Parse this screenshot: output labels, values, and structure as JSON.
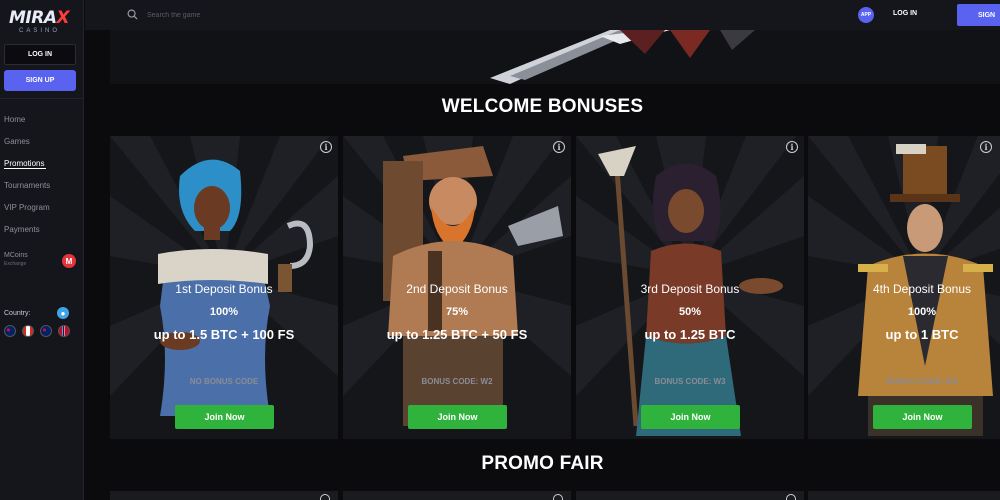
{
  "sidebar": {
    "logo_main": "MIRAX",
    "logo_sub": "CASINO",
    "login_label": "LOG IN",
    "signup_label": "SIGN UP",
    "nav": [
      {
        "label": "Home"
      },
      {
        "label": "Games"
      },
      {
        "label": "Promotions",
        "active": true
      },
      {
        "label": "Tournaments"
      },
      {
        "label": "VIP Program"
      },
      {
        "label": "Payments"
      }
    ],
    "mcoins_label": "MCoins",
    "mcoins_sub": "Exchange",
    "mcoins_badge": "M",
    "country_label": "Country:"
  },
  "topbar": {
    "search_placeholder": "Search the game",
    "app_label": "APP",
    "login_label": "LOG IN",
    "signup_label": "SIGN"
  },
  "welcome_title": "WELCOME BONUSES",
  "promo_title": "PROMO FAIR",
  "bonuses": [
    {
      "title": "1st Deposit Bonus",
      "percent": "100%",
      "amount": "up to 1.5 BTC + 100 FS",
      "code": "NO BONUS CODE",
      "button": "Join Now",
      "info": "i"
    },
    {
      "title": "2nd Deposit Bonus",
      "percent": "75%",
      "amount": "up to 1.25 BTC + 50 FS",
      "code": "BONUS CODE: W2",
      "button": "Join Now",
      "info": "i"
    },
    {
      "title": "3rd Deposit Bonus",
      "percent": "50%",
      "amount": "up to 1.25 BTC",
      "code": "BONUS CODE: W3",
      "button": "Join Now",
      "info": "i"
    },
    {
      "title": "4th Deposit Bonus",
      "percent": "100%",
      "amount": "up to 1 BTC",
      "code": "BONUS CODE: W4",
      "button": "Join Now",
      "info": "i"
    }
  ],
  "colors": {
    "accent": "#5a63f0",
    "join_button": "#2fb33c",
    "background": "#0b0b0e",
    "sidebar": "#15161b"
  }
}
